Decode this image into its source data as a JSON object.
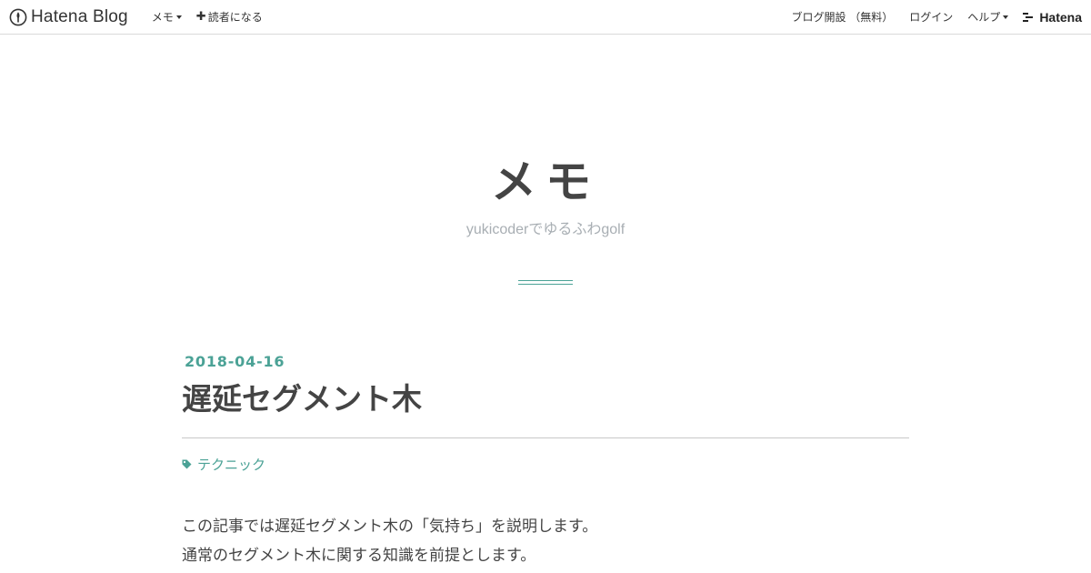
{
  "topbar": {
    "brand": "Hatena Blog",
    "blog_menu": "メモ",
    "subscribe": "読者になる",
    "signup": "ブログ開設 （無料）",
    "login": "ログイン",
    "help": "ヘルプ",
    "hatena": "Hatena"
  },
  "header": {
    "title": "メモ",
    "description": "yukicoderでゆるふわgolf"
  },
  "article": {
    "date": "2018-04-16",
    "title": "遅延セグメント木",
    "category": "テクニック",
    "paragraphs": [
      "この記事では遅延セグメント木の「気持ち」を説明します。",
      "通常のセグメント木に関する知識を前提とします。"
    ]
  },
  "colors": {
    "accent": "#4ba296",
    "text": "#444444",
    "muted": "#a8aeb3",
    "border": "#d9d9d9"
  }
}
